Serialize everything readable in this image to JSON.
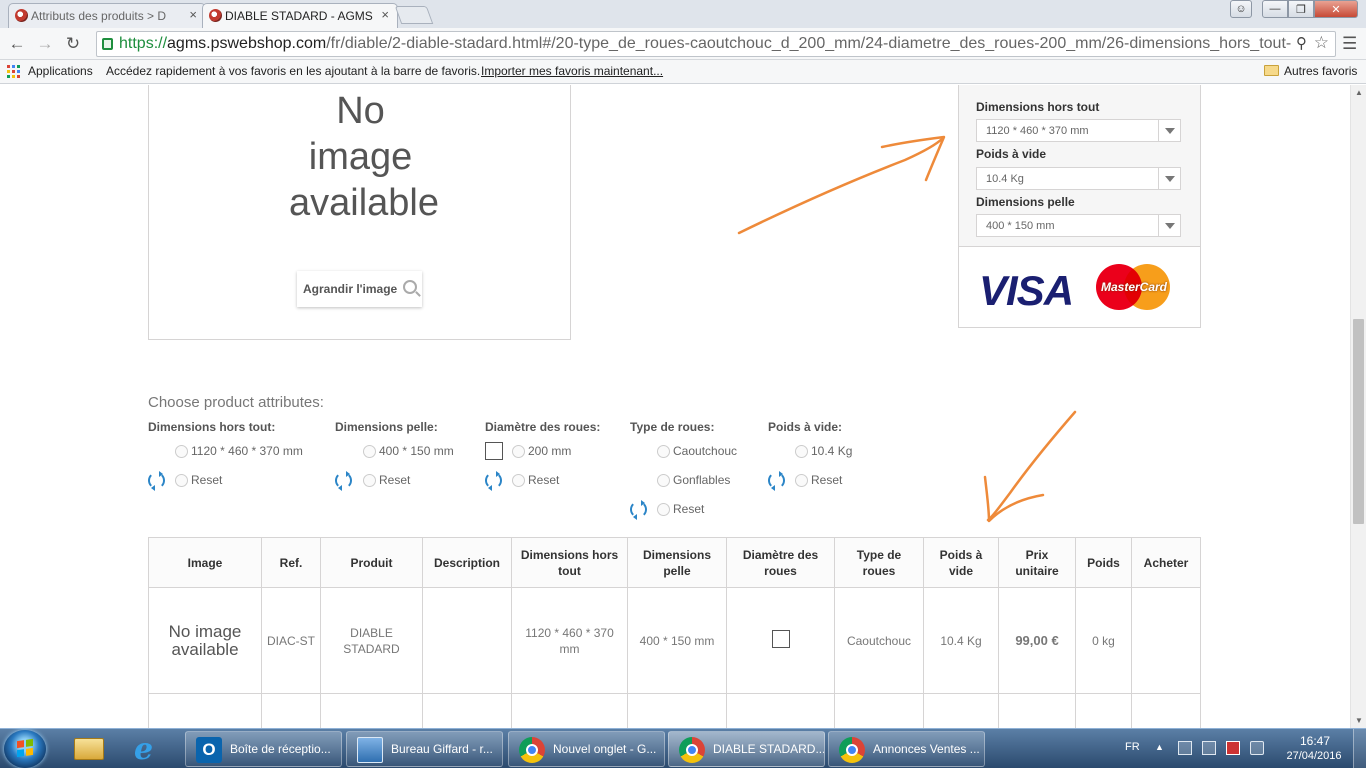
{
  "browser": {
    "tabs": [
      {
        "title": "Attributs des produits > D",
        "active": false
      },
      {
        "title": "DIABLE STADARD - AGMS",
        "active": true
      }
    ],
    "tab_close_glyph": "×",
    "url": {
      "scheme": "https://",
      "host": "agms.pswebshop.com",
      "path": "/fr/diable/2-diable-stadard.html#/20-type_de_roues-caoutchouc_d_200_mm/24-diametre_des_roues-200_mm/26-dimensions_hors_tout-"
    },
    "bookmarks": {
      "apps_label": "Applications",
      "hint": "Accédez rapidement à vos favoris en les ajoutant à la barre de favoris.",
      "import_link": "Importer mes favoris maintenant...",
      "other_favorites": "Autres favoris"
    }
  },
  "product_image": {
    "placeholder_text": "No image available",
    "zoom_label": "Agrandir l'image"
  },
  "right_panel": {
    "selects": [
      {
        "label": "Dimensions hors tout",
        "value": "1120 * 460 * 370 mm"
      },
      {
        "label": "Poids à vide",
        "value": "10.4 Kg"
      },
      {
        "label": "Dimensions pelle",
        "value": "400 * 150 mm"
      }
    ],
    "cards": {
      "visa": "VISA",
      "mastercard": "MasterCard"
    }
  },
  "attributes": {
    "title": "Choose product attributes:",
    "reset_label": "Reset",
    "groups": [
      {
        "heading": "Dimensions hors tout:",
        "options": [
          "1120 * 460 * 370 mm"
        ]
      },
      {
        "heading": "Dimensions pelle:",
        "options": [
          "400 * 150 mm"
        ]
      },
      {
        "heading": "Diamètre des roues:",
        "options": [
          "200 mm"
        ]
      },
      {
        "heading": "Type de roues:",
        "options": [
          "Caoutchouc",
          "Gonflables"
        ]
      },
      {
        "heading": "Poids à vide:",
        "options": [
          "10.4 Kg"
        ]
      }
    ]
  },
  "table": {
    "headers": [
      "Image",
      "Ref.",
      "Produit",
      "Description",
      "Dimensions hors tout",
      "Dimensions pelle",
      "Diamètre des roues",
      "Type de roues",
      "Poids à vide",
      "Prix unitaire",
      "Poids",
      "Acheter"
    ],
    "rows": [
      {
        "image": "No image available",
        "ref": "DIAC-ST",
        "product": "DIABLE STADARD",
        "description": "",
        "dimensions_hors_tout": "1120 * 460 * 370 mm",
        "dimensions_pelle": "400 * 150 mm",
        "diametre": "",
        "type_roues": "Caoutchouc",
        "poids_vide": "10.4 Kg",
        "prix": "99,00 €",
        "poids": "0 kg",
        "acheter": ""
      }
    ]
  },
  "taskbar": {
    "tasks": [
      {
        "label": "Boîte de réceptio...",
        "icon": "outlook-icon"
      },
      {
        "label": "Bureau Giffard - r...",
        "icon": "remote-desktop-icon"
      },
      {
        "label": "Nouvel onglet - G...",
        "icon": "chrome-icon"
      },
      {
        "label": "DIABLE STADARD...",
        "icon": "chrome-icon"
      },
      {
        "label": "Annonces Ventes ...",
        "icon": "chrome-icon"
      }
    ],
    "language": "FR",
    "time": "16:47",
    "date": "27/04/2016"
  },
  "colors": {
    "annotation_arrow": "#ee8a3a",
    "url_secure": "#1e8e3e",
    "reset_icon": "#2b85c7"
  }
}
